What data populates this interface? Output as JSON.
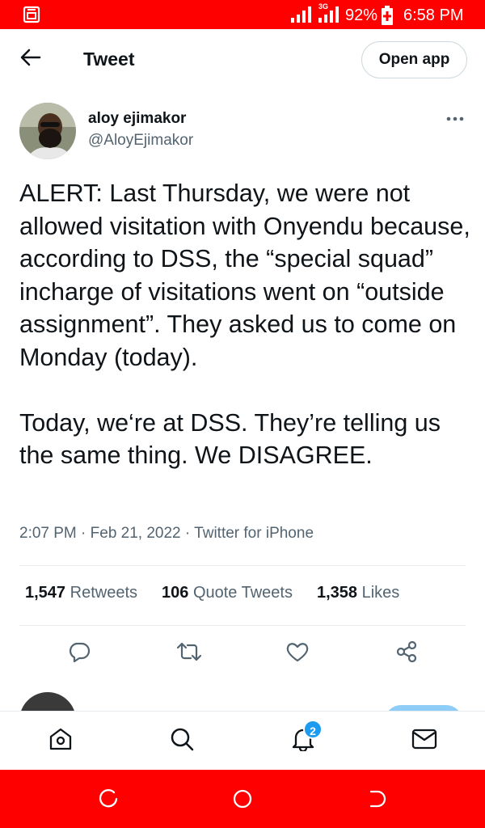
{
  "status_bar": {
    "network_type": "3G",
    "battery_percent": "92%",
    "time": "6:58 PM",
    "background_color": "#ff0000"
  },
  "header": {
    "title": "Tweet",
    "open_app_label": "Open app"
  },
  "tweet": {
    "author_name": "aloy ejimakor",
    "author_handle": "@AloyEjimakor",
    "text": "ALERT: Last Thursday, we were not allowed visitation with Onyendu because, according to DSS, the “special squad” incharge of visitations went on “outside assignment”. They asked us to come on Monday (today).\n\nToday, we‘re at DSS. They’re telling us the same thing. We DISAGREE.",
    "meta": "2:07 PM · Feb 21, 2022 · Twitter for iPhone",
    "stats": {
      "retweets_count": "1,547",
      "retweets_label": "Retweets",
      "quotes_count": "106",
      "quotes_label": "Quote Tweets",
      "likes_count": "1,358",
      "likes_label": "Likes"
    }
  },
  "actions": [
    "reply-icon",
    "retweet-icon",
    "like-icon",
    "share-icon"
  ],
  "bottom_nav": {
    "items": [
      "home-icon",
      "search-icon",
      "notifications-icon",
      "messages-icon"
    ],
    "notification_badge": "2",
    "accent_color": "#1d9bf0"
  }
}
